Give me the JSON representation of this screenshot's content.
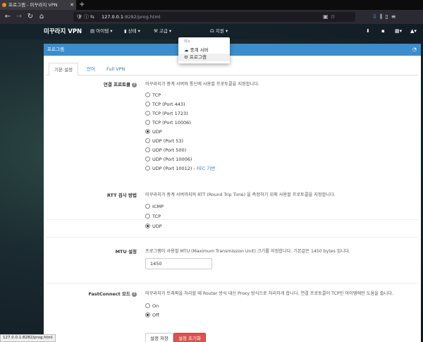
{
  "browser": {
    "tab_title": "프로그램 - 미꾸라지 VPN",
    "url_host": "127.0.0.1",
    "url_path": ":8282/prog.html",
    "status_url": "127.0.0.1:8282/prog.html"
  },
  "app": {
    "brand": "미꾸라지 VPN",
    "menu": [
      {
        "label": "아이템 ▾",
        "icon": "list-icon"
      },
      {
        "label": "상태 ▾",
        "icon": "chart-icon"
      },
      {
        "label": "고급 ▾",
        "icon": "wrench-icon"
      },
      {
        "label": "지원 ▾",
        "icon": "headset-icon"
      }
    ],
    "dropdown": {
      "header": "메뉴",
      "items": [
        {
          "label": "중계 서버",
          "icon": "cloud-icon"
        },
        {
          "label": "프로그램",
          "icon": "gear-icon"
        }
      ]
    }
  },
  "panel": {
    "title": "프로그램",
    "tabs": [
      "기본 설정",
      "언어",
      "Full VPN"
    ],
    "active_tab": 0
  },
  "settings": {
    "protocol": {
      "label": "연결 프로토콜",
      "desc": "미꾸라지가 중계 서버와 통신에 사용할 프로토콜을 지정합니다.",
      "options": [
        "TCP",
        "TCP (Port 443)",
        "TCP (Port 1723)",
        "TCP (Port 10006)",
        "UDP",
        "UDP (Port 53)",
        "UDP (Port 500)",
        "UDP (Port 10006)",
        "UDP (Port 10012) - "
      ],
      "fec_link": "FEC 기반",
      "selected": 4
    },
    "rtt": {
      "label": "RTT 검사 방법",
      "desc": "미꾸라지가 중계 서버까지의 RTT (Round Trip Time) 을 측정하기 위해 사용할 프로토콜을 지정합니다.",
      "options": [
        "ICMP",
        "TCP",
        "UDP"
      ],
      "selected": 2
    },
    "mtu": {
      "label": "MTU 설정",
      "desc": "프로그램이 사용할 MTU (Maximum Transmission Unit) 크기를 지정합니다. 기본값은 1450 bytes 입니다.",
      "value": "1450"
    },
    "fastconnect": {
      "label": "FastConnect 모드",
      "desc": "미꾸라지가 트래픽을 처리할 때 Router 방식 대신 Proxy 방식으로 처리하게 합니다. 연결 프로토콜이 TCP인 아이템에만 도움을 줍니다.",
      "options": [
        "On",
        "Off"
      ],
      "selected": 1
    }
  },
  "buttons": {
    "save": "설정 저장",
    "reset": "설정 초기화"
  }
}
